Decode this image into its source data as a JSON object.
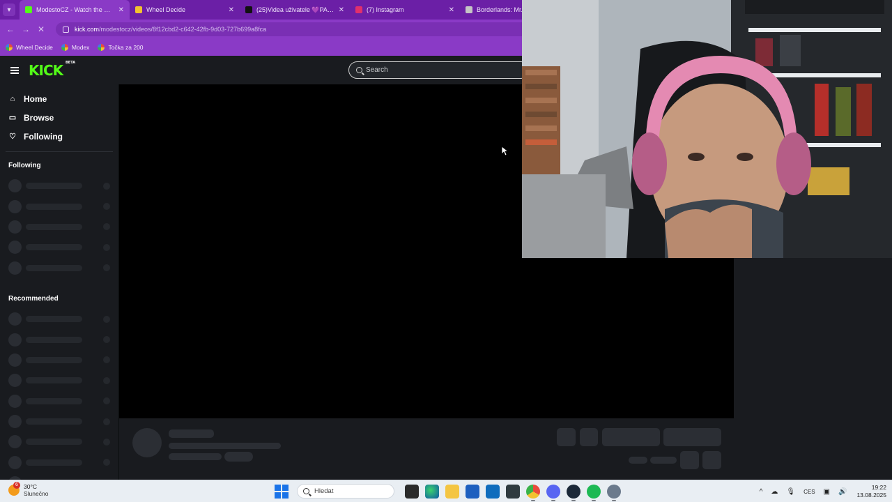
{
  "browser": {
    "tabs": [
      {
        "title": "ModestoCZ - Watch the VOD o",
        "active": true,
        "favicon_color": "#53fc18"
      },
      {
        "title": "Wheel Decide",
        "active": false,
        "favicon_color": "#f2c230"
      },
      {
        "title": "(25)Videa uživatele 💜PAJA💜",
        "active": false,
        "favicon_color": "#111111"
      },
      {
        "title": "(7) Instagram",
        "active": false,
        "favicon_color": "#e1306c"
      },
      {
        "title": "Borderlands: Mr. To",
        "active": false,
        "favicon_color": "#c5c5c5"
      }
    ],
    "url_host": "kick.com",
    "url_path": "/modestocz/videos/8f12cbd2-c642-42fb-9d03-727b699a8fca",
    "bookmarks": [
      "Wheel Decide",
      "Modex",
      "Točka za 200"
    ]
  },
  "kick": {
    "logo": "KICK",
    "logo_badge": "BETA",
    "search_placeholder": "Search",
    "nav": [
      {
        "label": "Home",
        "icon": "home-icon",
        "glyph": "⌂"
      },
      {
        "label": "Browse",
        "icon": "browse-icon",
        "glyph": "▭"
      },
      {
        "label": "Following",
        "icon": "heart-icon",
        "glyph": "♡"
      }
    ],
    "following_title": "Following",
    "recommended_title": "Recommended",
    "brand_color": "#53fc18"
  },
  "taskbar": {
    "weather_temp": "30°C",
    "weather_desc": "Slunečno",
    "weather_badge": "6",
    "search_placeholder": "Hledat",
    "language": "CES",
    "time": "19:22",
    "date": "13.08.2025"
  }
}
